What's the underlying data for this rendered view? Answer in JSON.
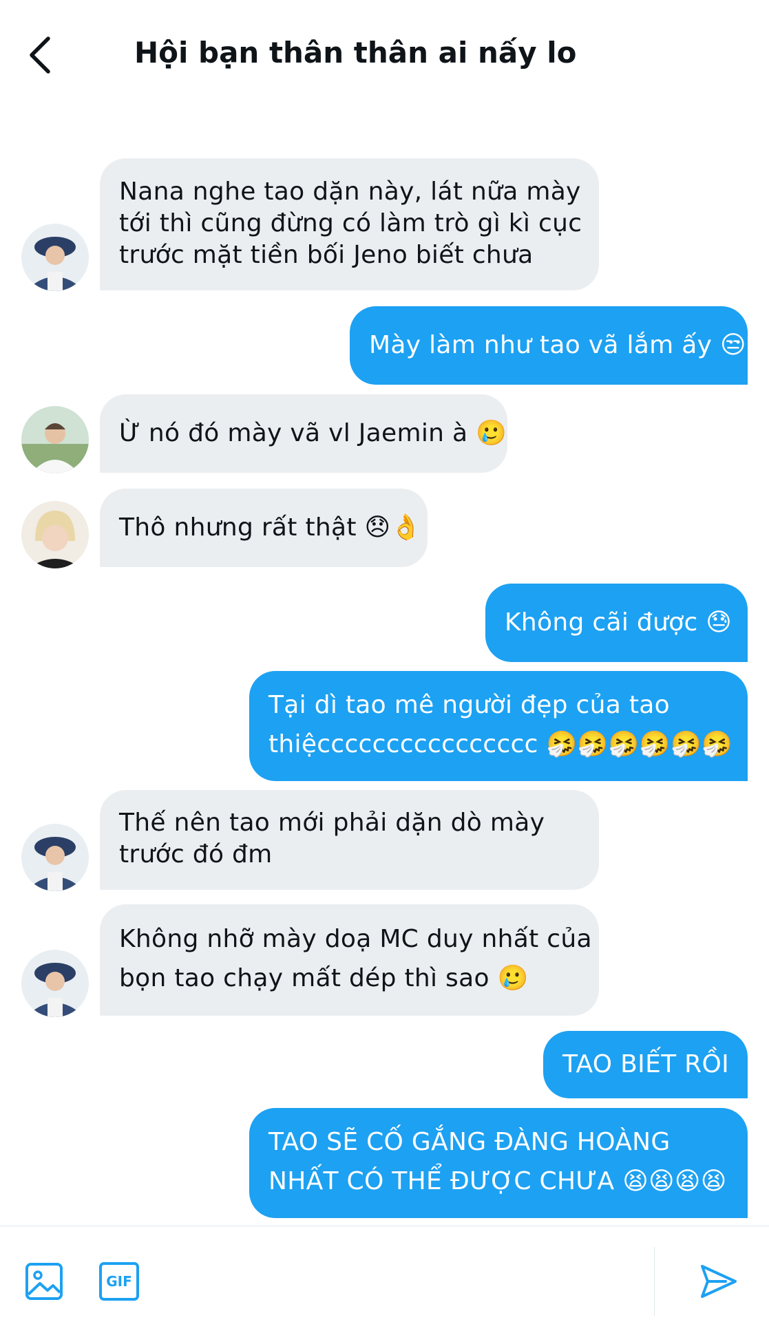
{
  "header": {
    "title": "Hội bạn thân thân ai nấy lo",
    "back_icon": "chevron-left-icon"
  },
  "colors": {
    "accent": "#1da1f2",
    "received_bubble": "#ebeef0",
    "text": "#0f1419"
  },
  "messages": [
    {
      "from": "them",
      "avatar": "avatar-bucket-hat",
      "lines": [
        "Nana nghe tao dặn này, lát nữa mày",
        "tới thì cũng đừng có làm trò gì kì cục",
        "trước mặt tiền bối Jeno biết chưa"
      ]
    },
    {
      "from": "me",
      "lines": [
        "Mày làm như tao vã lắm ấy 😒"
      ]
    },
    {
      "from": "them",
      "avatar": "avatar-white-shirt",
      "lines": [
        "Ừ nó đó mày vã vl Jaemin à 🥲"
      ]
    },
    {
      "from": "them",
      "avatar": "avatar-blonde",
      "lines": [
        "Thô nhưng rất thật 😞👌"
      ]
    },
    {
      "from": "me",
      "lines": [
        "Không cãi được 😓"
      ]
    },
    {
      "from": "me",
      "lines": [
        "Tại dì tao mê người đẹp của tao",
        "thiệcccccccccccccccc 🤧🤧🤧🤧🤧🤧"
      ]
    },
    {
      "from": "them",
      "avatar": "avatar-bucket-hat",
      "lines": [
        "Thế nên tao mới phải dặn dò mày",
        "trước đó đm"
      ]
    },
    {
      "from": "them",
      "avatar": "avatar-bucket-hat",
      "lines": [
        "Không nhỡ mày doạ MC duy nhất của",
        "bọn tao chạy mất dép thì sao 🥲"
      ]
    },
    {
      "from": "me",
      "lines": [
        "TAO BIẾT RỒI"
      ]
    },
    {
      "from": "me",
      "lines": [
        "TAO SẼ CỐ GẮNG ĐÀNG HOÀNG",
        "NHẤT CÓ THỂ ĐƯỢC CHƯA 😫😫😫😫"
      ]
    }
  ],
  "composer": {
    "image_icon": "image-icon",
    "gif_label": "GIF",
    "send_icon": "send-icon"
  }
}
